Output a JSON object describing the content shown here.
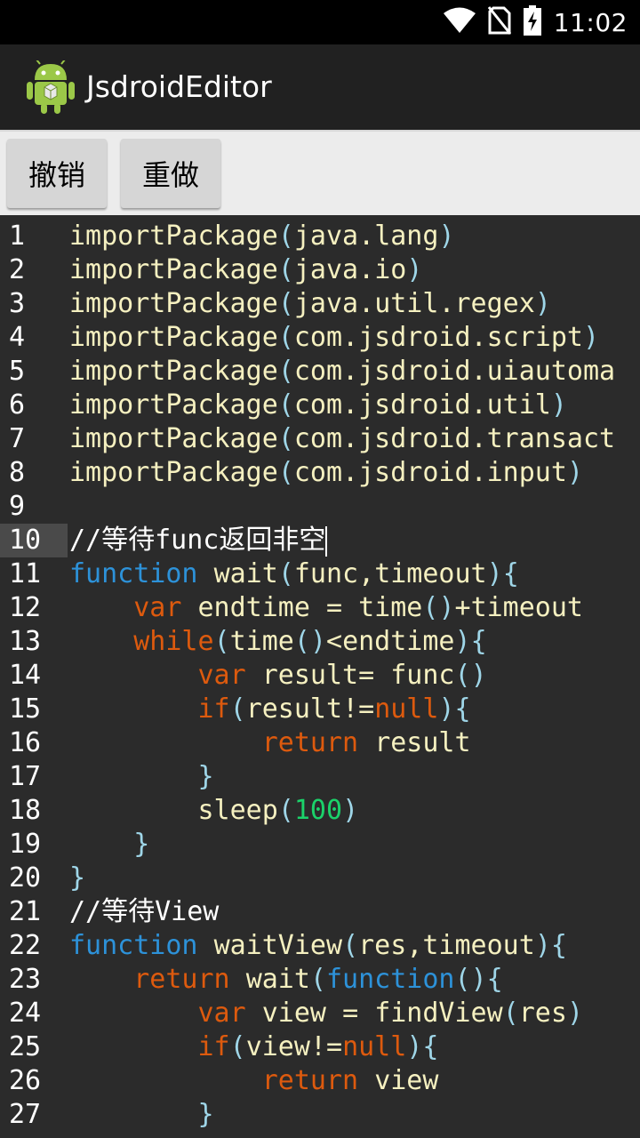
{
  "status_bar": {
    "time": "11:02",
    "icons": [
      "wifi-icon",
      "no-sim-icon",
      "battery-charging-icon"
    ]
  },
  "app_bar": {
    "title": "JsdroidEditor",
    "icon": "android-robot-icon"
  },
  "toolbar": {
    "undo_label": "撤销",
    "redo_label": "重做"
  },
  "editor": {
    "current_line": 10,
    "lines": [
      {
        "num": "1",
        "text": "importPackage(java.lang)"
      },
      {
        "num": "2",
        "text": "importPackage(java.io)"
      },
      {
        "num": "3",
        "text": "importPackage(java.util.regex)"
      },
      {
        "num": "4",
        "text": "importPackage(com.jsdroid.script)"
      },
      {
        "num": "5",
        "text": "importPackage(com.jsdroid.uiautoma"
      },
      {
        "num": "6",
        "text": "importPackage(com.jsdroid.util)"
      },
      {
        "num": "7",
        "text": "importPackage(com.jsdroid.transact"
      },
      {
        "num": "8",
        "text": "importPackage(com.jsdroid.input)"
      },
      {
        "num": "9",
        "text": ""
      },
      {
        "num": "10",
        "text": "//等待func返回非空"
      },
      {
        "num": "11",
        "text": "function wait(func,timeout){"
      },
      {
        "num": "12",
        "text": "    var endtime = time()+timeout"
      },
      {
        "num": "13",
        "text": "    while(time()<endtime){"
      },
      {
        "num": "14",
        "text": "        var result= func()"
      },
      {
        "num": "15",
        "text": "        if(result!=null){"
      },
      {
        "num": "16",
        "text": "            return result"
      },
      {
        "num": "17",
        "text": "        }"
      },
      {
        "num": "18",
        "text": "        sleep(100)"
      },
      {
        "num": "19",
        "text": "    }"
      },
      {
        "num": "20",
        "text": "}"
      },
      {
        "num": "21",
        "text": "//等待View"
      },
      {
        "num": "22",
        "text": "function waitView(res,timeout){"
      },
      {
        "num": "23",
        "text": "    return wait(function(){"
      },
      {
        "num": "24",
        "text": "        var view = findView(res)"
      },
      {
        "num": "25",
        "text": "        if(view!=null){"
      },
      {
        "num": "26",
        "text": "            return view"
      },
      {
        "num": "27",
        "text": "        }"
      }
    ]
  },
  "colors": {
    "keyword_blue": "#2d92d9",
    "keyword_orange": "#dd5a0e",
    "number_green": "#1bd26a",
    "identifier": "#f5f0c0",
    "paren": "#9fd6e8",
    "background": "#2b2b2b"
  }
}
